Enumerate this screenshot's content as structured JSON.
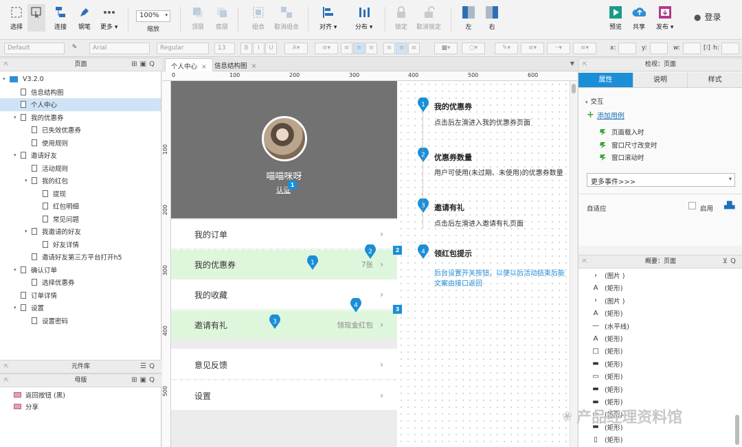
{
  "toolbar": {
    "select": "选择",
    "connect": "连接",
    "pen": "钢笔",
    "more": "更多 ▾",
    "zoom_value": "100%",
    "zoom_label": "缩放",
    "top": "顶层",
    "bottom": "底层",
    "group": "组合",
    "ungroup": "取消组合",
    "align": "对齐 ▾",
    "distribute": "分布 ▾",
    "lock": "锁定",
    "unlock": "取消锁定",
    "left": "左",
    "right": "右",
    "preview": "预览",
    "share": "共享",
    "publish": "发布 ▾",
    "login": "登录"
  },
  "format": {
    "style": "Default",
    "font": "Arial",
    "weight": "Regular",
    "size": "13",
    "x_label": "x:",
    "y_label": "y:",
    "w_label": "w:",
    "h_label": "h:"
  },
  "pages_panel": {
    "title": "页面",
    "items": [
      {
        "label": "V3.2.0",
        "depth": 0,
        "caret": "▾",
        "folder": true
      },
      {
        "label": "信息结构图",
        "depth": 1
      },
      {
        "label": "个人中心",
        "depth": 1,
        "selected": true
      },
      {
        "label": "我的优惠券",
        "depth": 1,
        "caret": "▾"
      },
      {
        "label": "已失效优惠券",
        "depth": 2
      },
      {
        "label": "使用规则",
        "depth": 2
      },
      {
        "label": "邀请好友",
        "depth": 1,
        "caret": "▾"
      },
      {
        "label": "活动规则",
        "depth": 2
      },
      {
        "label": "我的红包",
        "depth": 2,
        "caret": "▾"
      },
      {
        "label": "提现",
        "depth": 3
      },
      {
        "label": "红包明细",
        "depth": 3
      },
      {
        "label": "常见问题",
        "depth": 3
      },
      {
        "label": "我邀请的好友",
        "depth": 2,
        "caret": "▾"
      },
      {
        "label": "好友详情",
        "depth": 3
      },
      {
        "label": "邀请好友第三方平台打开h5",
        "depth": 2
      },
      {
        "label": "确认订单",
        "depth": 1,
        "caret": "▾"
      },
      {
        "label": "选择优惠券",
        "depth": 2
      },
      {
        "label": "订单详情",
        "depth": 1
      },
      {
        "label": "设置",
        "depth": 1,
        "caret": "▾"
      },
      {
        "label": "设置密码",
        "depth": 2
      }
    ]
  },
  "widgets_panel": {
    "title": "元件库"
  },
  "masters_panel": {
    "title": "母版",
    "items": [
      "返回按钮 (黑)",
      "分享"
    ]
  },
  "tabs": [
    {
      "label": "个人中心",
      "active": true
    },
    {
      "label": "信息结构图",
      "active": false
    }
  ],
  "ruler_h": [
    "0",
    "100",
    "200",
    "300",
    "400",
    "500",
    "600"
  ],
  "ruler_v": [
    "100",
    "200",
    "300",
    "400",
    "500"
  ],
  "mock": {
    "nickname": "喵喵咪呀",
    "auth": "认证",
    "rows": [
      {
        "label": "我的订单",
        "value": "",
        "highlight": false
      },
      {
        "label": "我的优惠券",
        "value": "7张",
        "highlight": true
      },
      {
        "label": "我的收藏",
        "value": "",
        "highlight": false
      },
      {
        "label": "邀请有礼",
        "value": "领现金红包",
        "highlight": true
      },
      {
        "label": "意见反馈",
        "value": "",
        "highlight": false
      },
      {
        "label": "设置",
        "value": "",
        "highlight": false
      }
    ],
    "arrow": "›",
    "badges": [
      "1",
      "2",
      "3"
    ],
    "pins": [
      "1",
      "2",
      "3",
      "4"
    ]
  },
  "notes": [
    {
      "num": "1",
      "title": "我的优惠券",
      "text": "点击后左滑进入我的优惠券页面",
      "blue": false
    },
    {
      "num": "2",
      "title": "优惠券数量",
      "text": "用户可使用(未过期、未使用)的优惠券数量",
      "blue": false
    },
    {
      "num": "3",
      "title": "邀请有礼",
      "text": "点击后左滑进入邀请有礼页面",
      "blue": false
    },
    {
      "num": "4",
      "title": "领红包提示",
      "text": "后台设置开关按钮，以便以后活动结束后能",
      "text2": "文案由接口返回",
      "blue": true
    }
  ],
  "inspector": {
    "title": "检视：页面",
    "tabs": [
      "属性",
      "说明",
      "样式"
    ],
    "interaction": "交互",
    "add_case": "添加用例",
    "events": [
      "页面载入时",
      "窗口尺寸改变时",
      "窗口滚动时"
    ],
    "more_events": "更多事件>>>",
    "adaptive": "自适应",
    "enable": "启用"
  },
  "outline": {
    "title": "概要：页面",
    "items": [
      {
        "icon": "chevron",
        "label": "(图片 )"
      },
      {
        "icon": "text",
        "label": "(矩形)"
      },
      {
        "icon": "chevron",
        "label": "(图片 )"
      },
      {
        "icon": "text",
        "label": "(矩形)"
      },
      {
        "icon": "line",
        "label": "(水平线)"
      },
      {
        "icon": "text",
        "label": "(矩形)"
      },
      {
        "icon": "box",
        "label": "(矩形)"
      },
      {
        "icon": "flat",
        "label": "(矩形)"
      },
      {
        "icon": "rect",
        "label": "(矩形)"
      },
      {
        "icon": "flat",
        "label": "(矩形)"
      },
      {
        "icon": "flat",
        "label": "(矩形)"
      },
      {
        "icon": "rect",
        "label": "(矩形)"
      },
      {
        "icon": "flat",
        "label": "(矩形)"
      },
      {
        "icon": "tall",
        "label": "(矩形)"
      }
    ]
  },
  "watermark": "产品经理资料馆"
}
